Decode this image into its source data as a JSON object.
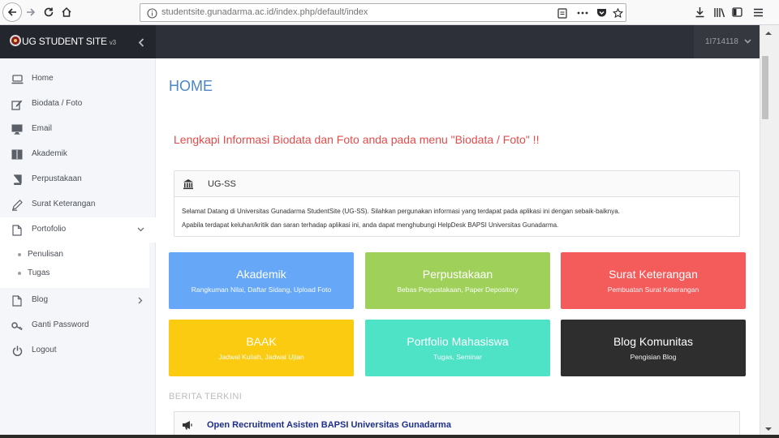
{
  "browser": {
    "url": "studentsite.gunadarma.ac.id/index.php/default/index"
  },
  "sidebar": {
    "brand": "UG STUDENT SITE",
    "brand_version": "v3",
    "items": [
      {
        "label": "Home",
        "icon": "laptop-icon"
      },
      {
        "label": "Biodata / Foto",
        "icon": "edit-icon"
      },
      {
        "label": "Email",
        "icon": "monitor-icon"
      },
      {
        "label": "Akademik",
        "icon": "book-icon"
      },
      {
        "label": "Perpustakaan",
        "icon": "books-icon"
      },
      {
        "label": "Surat Keterangan",
        "icon": "pen-icon"
      },
      {
        "label": "Portofolio",
        "icon": "document-icon"
      },
      {
        "label": "Blog",
        "icon": "document-icon"
      },
      {
        "label": "Ganti Password",
        "icon": "key-icon"
      },
      {
        "label": "Logout",
        "icon": "power-icon"
      }
    ],
    "portofolio_sub": [
      "Penulisan",
      "Tugas"
    ]
  },
  "topbar": {
    "user": "1I714118"
  },
  "main": {
    "title": "HOME",
    "notice": "Lengkapi Informasi Biodata dan Foto anda pada menu \"Biodata / Foto\" !!",
    "info_title": "UG-SS",
    "info_line1": "Selamat Datang di Universitas Gunadarma StudentSite (UG-SS). Silahkan pergunakan informasi yang terdapat pada aplikasi ini dengan sebaik-baiknya.",
    "info_line2": "Apabila terdapat keluhan/kritik dan saran terhadap aplikasi ini, anda dapat menghubungi HelpDesk BAPSI Universitas Gunadarma.",
    "tiles": [
      {
        "title": "Akademik",
        "sub": "Rangkuman Nilai, Daftar Sidang, Upload Foto",
        "color": "#66a8f7"
      },
      {
        "title": "Perpustakaan",
        "sub": "Bebas Perpustakaan, Paper Depository",
        "color": "#9fd15a"
      },
      {
        "title": "Surat Keterangan",
        "sub": "Pembuatan Surat Keterangan",
        "color": "#f45b5b"
      },
      {
        "title": "BAAK",
        "sub": "Jadwal Kuliah, Jadwal Ujian",
        "color": "#fbcb12"
      },
      {
        "title": "Portfolio Mahasiswa",
        "sub": "Tugas, Seminar",
        "color": "#4ee2c6"
      },
      {
        "title": "Blog Komunitas",
        "sub": "Pengisian Blog",
        "color": "#2e2e2e"
      }
    ],
    "news_heading": "BERITA TERKINI",
    "news_item": "Open Recruitment Asisten BAPSI Universitas Gunadarma"
  },
  "colors": {
    "sidebar_header": "#23262c",
    "topbar": "#2d3038",
    "title": "#4a86c8",
    "notice": "#e44c4c",
    "link": "#1d2f8a"
  }
}
